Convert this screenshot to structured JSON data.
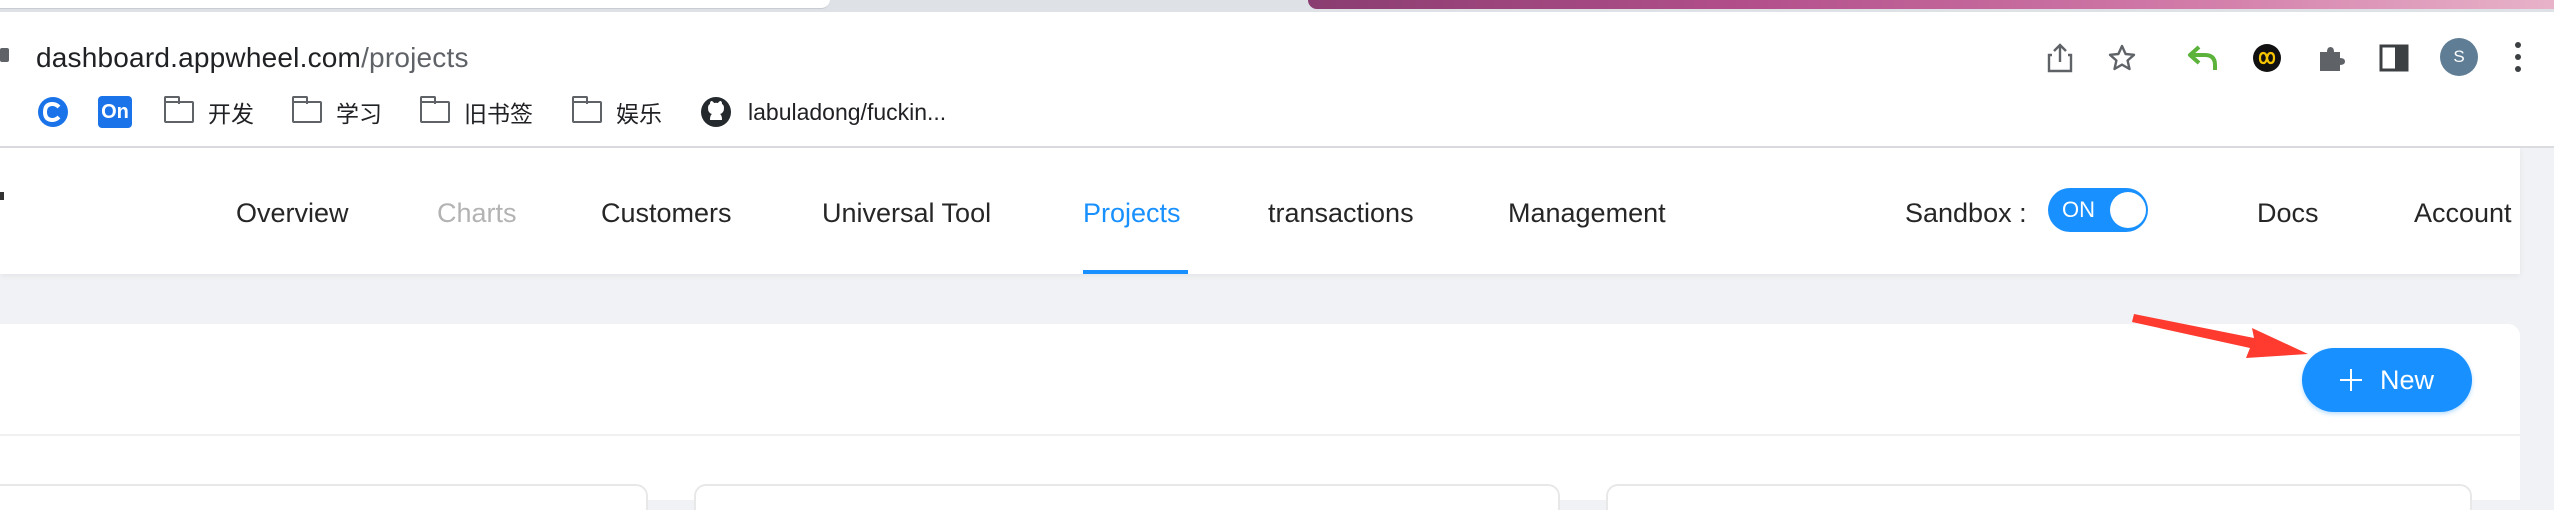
{
  "browser": {
    "url_domain": "dashboard.appwheel.com",
    "url_path": "/projects",
    "avatar_letter": "S",
    "bookmarks": [
      {
        "label": "On"
      },
      {
        "label": "开发"
      },
      {
        "label": "学习"
      },
      {
        "label": "旧书签"
      },
      {
        "label": "娱乐"
      },
      {
        "label": "labuladong/fuckin..."
      }
    ],
    "toolbar_icons": [
      "share-icon",
      "star-icon",
      "undo-extension-icon",
      "infinity-extension-icon",
      "extensions-puzzle-icon",
      "side-panel-icon",
      "profile-avatar",
      "more-menu-icon"
    ],
    "accent_colors": {
      "tab_gradient_start": "#8a3d70",
      "tab_gradient_end": "#e8b3c9"
    }
  },
  "nav": {
    "items": [
      {
        "label": "Overview",
        "state": "normal"
      },
      {
        "label": "Charts",
        "state": "disabled"
      },
      {
        "label": "Customers",
        "state": "normal"
      },
      {
        "label": "Universal Tool",
        "state": "normal"
      },
      {
        "label": "Projects",
        "state": "active"
      },
      {
        "label": "transactions",
        "state": "normal"
      },
      {
        "label": "Management",
        "state": "normal"
      }
    ],
    "sandbox_label": "Sandbox :",
    "sandbox_toggle": "ON",
    "docs": "Docs",
    "account": "Account"
  },
  "main": {
    "new_button": "New"
  },
  "colors": {
    "primary": "#1890ff",
    "annotation_arrow": "#ff3b30"
  }
}
